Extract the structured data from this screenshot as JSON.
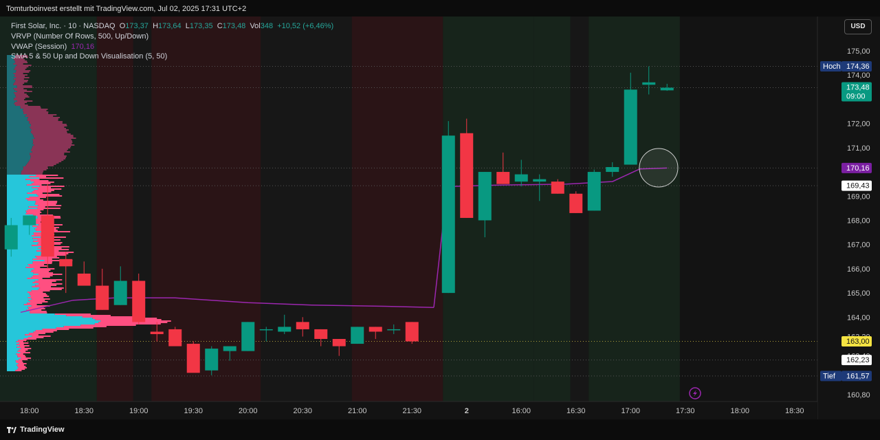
{
  "topbar": {
    "title": "Tomturboinvest erstellt mit TradingView.com, Jul 02, 2025 17:31 UTC+2"
  },
  "legend": {
    "line1_symbol": "First Solar, Inc. · 10 · NASDAQ",
    "o_label": "O",
    "o_value": "173,37",
    "h_label": "H",
    "h_value": "173,64",
    "l_label": "L",
    "l_value": "173,35",
    "c_label": "C",
    "c_value": "173,48",
    "vol_label": "Vol",
    "vol_value": "348",
    "change": "+10,52 (+6,46%)",
    "line2": "VRVP (Number Of Rows, 500, Up/Down)",
    "line3_name": "VWAP (Session)",
    "line3_value": "170,16",
    "line4": "SMA 5 & 50 Up and Down Visualisation (5, 50)"
  },
  "currency_button": "USD",
  "brand": "TradingView",
  "colors": {
    "up": "#089981",
    "down": "#f23645",
    "vwap": "#9c27b0",
    "vp_up": "#26c6da",
    "vp_down": "#ff4f81",
    "bg": "#131313"
  },
  "chart_data": {
    "type": "candlestick",
    "y_range": [
      160.4,
      175.7
    ],
    "y_ticks": [
      "175,00",
      "174,00",
      "172,00",
      "171,00",
      "169,00",
      "168,00",
      "167,00",
      "166,00",
      "165,00",
      "164,00",
      "163,20",
      "162,40",
      "160,80"
    ],
    "y_tick_values": [
      175,
      174,
      172,
      171,
      169,
      168,
      167,
      166,
      165,
      164,
      163.2,
      162.4,
      160.8
    ],
    "x_ticks": [
      "18:00",
      "18:30",
      "19:00",
      "19:30",
      "20:00",
      "20:30",
      "21:00",
      "21:30",
      "2",
      "16:00",
      "16:30",
      "17:00",
      "17:30",
      "18:00",
      "18:30"
    ],
    "x_tick_slots": [
      1,
      4,
      7,
      10,
      13,
      16,
      19,
      22,
      25,
      28,
      31,
      34,
      37,
      40,
      43
    ],
    "price_labels": [
      {
        "title": "Hoch",
        "value": "174,36",
        "price": 174.36,
        "style": "high"
      },
      {
        "title": "",
        "value": "173,48",
        "sub": "09:00",
        "price": 173.48,
        "style": "last"
      },
      {
        "title": "",
        "value": "170,16",
        "price": 170.16,
        "style": "vwap"
      },
      {
        "title": "",
        "value": "169,43",
        "price": 169.43,
        "style": "white"
      },
      {
        "title": "",
        "value": "163,00",
        "price": 163.0,
        "style": "yellow"
      },
      {
        "title": "",
        "value": "162,23",
        "price": 162.23,
        "style": "white"
      },
      {
        "title": "Tief",
        "value": "161,57",
        "price": 161.57,
        "style": "low"
      }
    ],
    "candles": [
      {
        "o": 166.8,
        "h": 168.1,
        "l": 166.5,
        "c": 167.8
      },
      {
        "o": 167.8,
        "h": 168.2,
        "l": 167.4,
        "c": 168.2
      },
      {
        "o": 168.2,
        "h": 169.5,
        "l": 166.0,
        "c": 166.5
      },
      {
        "o": 166.4,
        "h": 166.7,
        "l": 165.0,
        "c": 166.1
      },
      {
        "o": 165.8,
        "h": 166.3,
        "l": 165.4,
        "c": 165.3
      },
      {
        "o": 165.3,
        "h": 166.0,
        "l": 164.3,
        "c": 164.3
      },
      {
        "o": 164.5,
        "h": 166.1,
        "l": 164.5,
        "c": 165.5
      },
      {
        "o": 165.5,
        "h": 165.8,
        "l": 163.7,
        "c": 163.8
      },
      {
        "o": 163.4,
        "h": 163.8,
        "l": 163.0,
        "c": 163.3
      },
      {
        "o": 163.5,
        "h": 163.6,
        "l": 162.9,
        "c": 162.8
      },
      {
        "o": 162.9,
        "h": 163.0,
        "l": 161.8,
        "c": 161.7
      },
      {
        "o": 161.8,
        "h": 162.8,
        "l": 161.6,
        "c": 162.7
      },
      {
        "o": 162.6,
        "h": 162.7,
        "l": 162.2,
        "c": 162.8
      },
      {
        "o": 162.6,
        "h": 163.8,
        "l": 162.6,
        "c": 163.8
      },
      {
        "o": 163.5,
        "h": 163.6,
        "l": 163.0,
        "c": 163.5
      },
      {
        "o": 163.4,
        "h": 164.1,
        "l": 163.3,
        "c": 163.6
      },
      {
        "o": 163.8,
        "h": 164.0,
        "l": 163.2,
        "c": 163.5
      },
      {
        "o": 163.5,
        "h": 163.5,
        "l": 162.8,
        "c": 163.1
      },
      {
        "o": 163.1,
        "h": 163.1,
        "l": 162.4,
        "c": 162.8
      },
      {
        "o": 162.9,
        "h": 163.6,
        "l": 162.9,
        "c": 163.6
      },
      {
        "o": 163.6,
        "h": 163.6,
        "l": 163.1,
        "c": 163.4
      },
      {
        "o": 163.5,
        "h": 163.7,
        "l": 163.3,
        "c": 163.5
      },
      {
        "o": 163.8,
        "h": 163.8,
        "l": 162.9,
        "c": 163.0
      },
      {
        "o": 165.0,
        "h": 172.1,
        "l": 165.0,
        "c": 171.5
      },
      {
        "o": 171.6,
        "h": 172.2,
        "l": 168.1,
        "c": 168.1
      },
      {
        "o": 168.0,
        "h": 170.0,
        "l": 167.3,
        "c": 170.0
      },
      {
        "o": 170.0,
        "h": 170.8,
        "l": 169.5,
        "c": 169.5
      },
      {
        "o": 169.6,
        "h": 170.5,
        "l": 169.4,
        "c": 169.9
      },
      {
        "o": 169.6,
        "h": 169.9,
        "l": 168.8,
        "c": 169.7
      },
      {
        "o": 169.6,
        "h": 169.7,
        "l": 169.1,
        "c": 169.1
      },
      {
        "o": 169.1,
        "h": 169.2,
        "l": 168.3,
        "c": 168.3
      },
      {
        "o": 168.4,
        "h": 170.1,
        "l": 168.4,
        "c": 170.0
      },
      {
        "o": 170.0,
        "h": 170.4,
        "l": 169.8,
        "c": 170.2
      },
      {
        "o": 170.3,
        "h": 174.1,
        "l": 170.3,
        "c": 173.4
      },
      {
        "o": 173.6,
        "h": 174.36,
        "l": 173.2,
        "c": 173.7
      },
      {
        "o": 173.37,
        "h": 173.64,
        "l": 173.35,
        "c": 173.48
      }
    ]
  }
}
